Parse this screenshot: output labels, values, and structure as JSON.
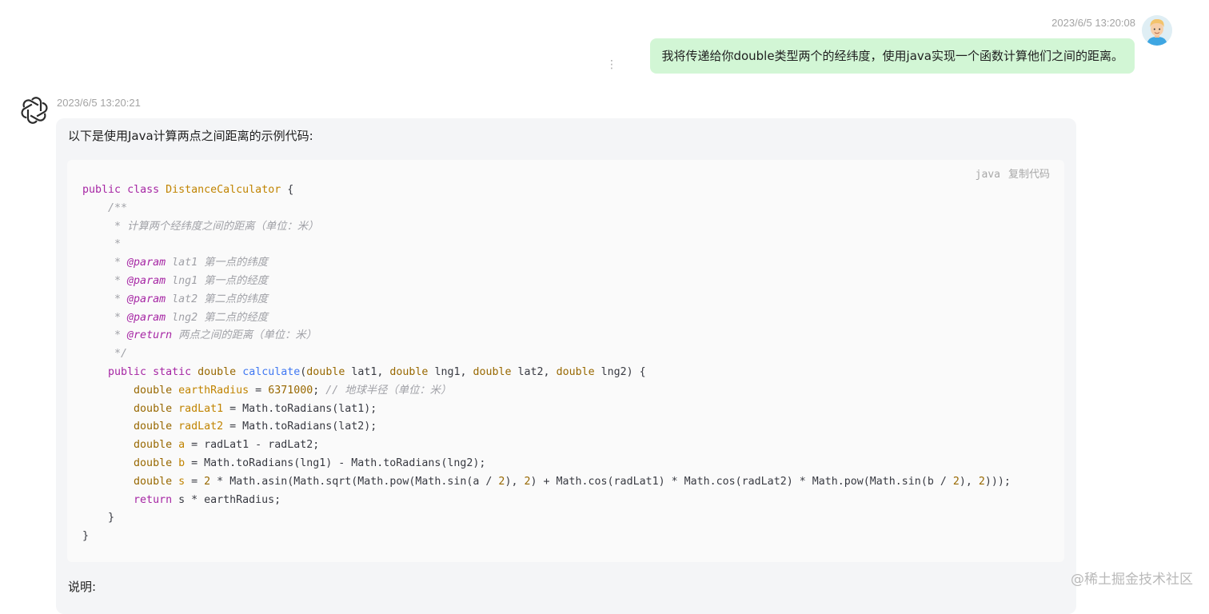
{
  "user_message": {
    "timestamp": "2023/6/5 13:20:08",
    "text": "我将传递给你double类型两个的经纬度，使用java实现一个函数计算他们之间的距离。",
    "more_icon": "⋮"
  },
  "assistant_message": {
    "timestamp": "2023/6/5 13:20:21",
    "intro": "以下是使用Java计算两点之间距离的示例代码:",
    "code_block": {
      "language": "java",
      "copy_label": "复制代码",
      "lines": [
        [
          [
            "public",
            "kw"
          ],
          [
            " ",
            ""
          ],
          [
            "class",
            "kw"
          ],
          [
            " ",
            ""
          ],
          [
            "DistanceCalculator",
            "cls"
          ],
          [
            " {",
            ""
          ]
        ],
        [
          [
            "    ",
            ""
          ],
          [
            "/**",
            "com"
          ]
        ],
        [
          [
            "     ",
            ""
          ],
          [
            "* 计算两个经纬度之间的距离（单位：米）",
            "com"
          ]
        ],
        [
          [
            "     ",
            ""
          ],
          [
            "*",
            "com"
          ]
        ],
        [
          [
            "     ",
            ""
          ],
          [
            "* ",
            "com"
          ],
          [
            "@param",
            "doctag"
          ],
          [
            " lat1 第一点的纬度",
            "pa"
          ]
        ],
        [
          [
            "     ",
            ""
          ],
          [
            "* ",
            "com"
          ],
          [
            "@param",
            "doctag"
          ],
          [
            " lng1 第一点的经度",
            "pa"
          ]
        ],
        [
          [
            "     ",
            ""
          ],
          [
            "* ",
            "com"
          ],
          [
            "@param",
            "doctag"
          ],
          [
            " lat2 第二点的纬度",
            "pa"
          ]
        ],
        [
          [
            "     ",
            ""
          ],
          [
            "* ",
            "com"
          ],
          [
            "@param",
            "doctag"
          ],
          [
            " lng2 第二点的经度",
            "pa"
          ]
        ],
        [
          [
            "     ",
            ""
          ],
          [
            "* ",
            "com"
          ],
          [
            "@return",
            "doctag"
          ],
          [
            " 两点之间的距离（单位：米）",
            "pa"
          ]
        ],
        [
          [
            "     ",
            ""
          ],
          [
            "*/",
            "com"
          ]
        ],
        [
          [
            "    ",
            ""
          ],
          [
            "public",
            "kw"
          ],
          [
            " ",
            ""
          ],
          [
            "static",
            "kw"
          ],
          [
            " ",
            ""
          ],
          [
            "double",
            "ty"
          ],
          [
            " ",
            ""
          ],
          [
            "calculate",
            "fn"
          ],
          [
            "(",
            ""
          ],
          [
            "double",
            "ty"
          ],
          [
            " lat1, ",
            ""
          ],
          [
            "double",
            "ty"
          ],
          [
            " lng1, ",
            ""
          ],
          [
            "double",
            "ty"
          ],
          [
            " lat2, ",
            ""
          ],
          [
            "double",
            "ty"
          ],
          [
            " lng2) {",
            ""
          ]
        ],
        [
          [
            "        ",
            ""
          ],
          [
            "double",
            "ty"
          ],
          [
            " ",
            ""
          ],
          [
            "earthRadius",
            "cls"
          ],
          [
            " = ",
            ""
          ],
          [
            "6371000",
            "num"
          ],
          [
            "; ",
            ""
          ],
          [
            "// 地球半径（单位：米）",
            "com"
          ]
        ],
        [
          [
            "        ",
            ""
          ],
          [
            "double",
            "ty"
          ],
          [
            " ",
            ""
          ],
          [
            "radLat1",
            "cls"
          ],
          [
            " = Math.toRadians(lat1);",
            ""
          ]
        ],
        [
          [
            "        ",
            ""
          ],
          [
            "double",
            "ty"
          ],
          [
            " ",
            ""
          ],
          [
            "radLat2",
            "cls"
          ],
          [
            " = Math.toRadians(lat2);",
            ""
          ]
        ],
        [
          [
            "        ",
            ""
          ],
          [
            "double",
            "ty"
          ],
          [
            " ",
            ""
          ],
          [
            "a",
            "cls"
          ],
          [
            " = radLat1 - radLat2;",
            ""
          ]
        ],
        [
          [
            "        ",
            ""
          ],
          [
            "double",
            "ty"
          ],
          [
            " ",
            ""
          ],
          [
            "b",
            "cls"
          ],
          [
            " = Math.toRadians(lng1) - Math.toRadians(lng2);",
            ""
          ]
        ],
        [
          [
            "        ",
            ""
          ],
          [
            "double",
            "ty"
          ],
          [
            " ",
            ""
          ],
          [
            "s",
            "cls"
          ],
          [
            " = ",
            ""
          ],
          [
            "2",
            "num"
          ],
          [
            " * Math.asin(Math.sqrt(Math.pow(Math.sin(a / ",
            ""
          ],
          [
            "2",
            "num"
          ],
          [
            "), ",
            ""
          ],
          [
            "2",
            "num"
          ],
          [
            ") + Math.cos(radLat1) * Math.cos(radLat2) * Math.pow(Math.sin(b / ",
            ""
          ],
          [
            "2",
            "num"
          ],
          [
            "), ",
            ""
          ],
          [
            "2",
            "num"
          ],
          [
            ")));",
            ""
          ]
        ],
        [
          [
            "        ",
            ""
          ],
          [
            "return",
            "kw"
          ],
          [
            " s * earthRadius;",
            ""
          ]
        ],
        [
          [
            "    }",
            ""
          ]
        ],
        [
          [
            "}",
            ""
          ]
        ]
      ]
    },
    "explanation_heading": "说明:"
  },
  "watermark": "@稀土掘金技术社区"
}
